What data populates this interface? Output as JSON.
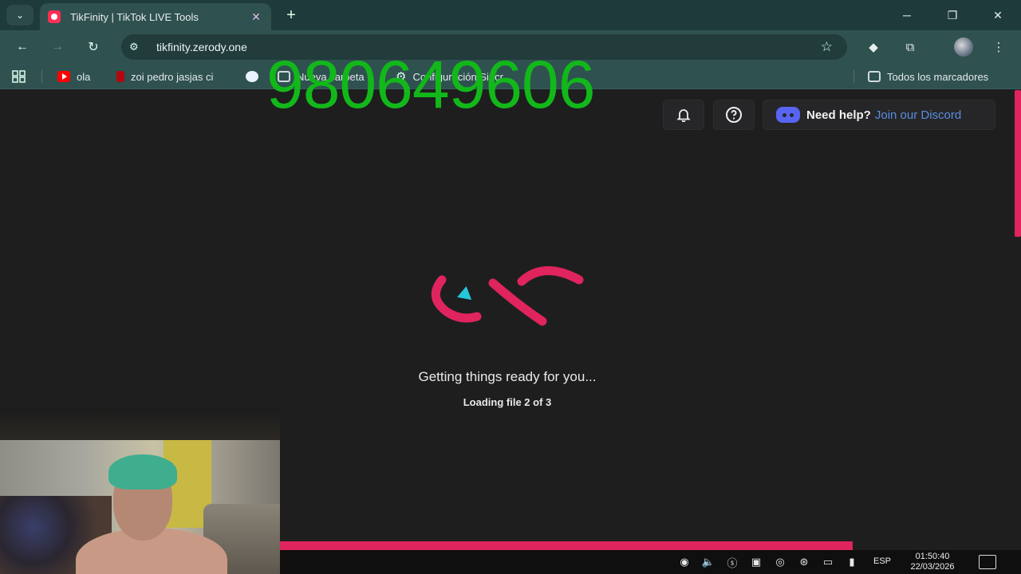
{
  "browser": {
    "tab": {
      "title": "TikFinity | TikTok LIVE Tools",
      "close": "✕"
    },
    "new_tab": "+",
    "window_controls": {
      "minimize": "─",
      "maximize": "❐",
      "close": "✕"
    },
    "url": "tikfinity.zerody.one",
    "bookmarks": [
      {
        "label": "ola",
        "icon": "youtube-icon"
      },
      {
        "label": "zoi pedro jasjas ci",
        "icon": "netflix-icon"
      },
      {
        "label": "",
        "icon": "whatsapp-icon"
      },
      {
        "label": "Nueva carpeta",
        "icon": "folder-icon"
      },
      {
        "label": "Configuración Sincr...",
        "icon": "gear-icon"
      }
    ],
    "all_bookmarks": "Todos los marcadores"
  },
  "overlay": {
    "number": "980649606"
  },
  "page": {
    "help": {
      "strong": "Need help?",
      "link": "Join our Discord"
    },
    "status": "Getting things ready for you...",
    "loading": "Loading file 2 of 3",
    "progress": 0.78
  },
  "taskbar": {
    "language": "ESP",
    "time": "01:50:40",
    "date": "22/03/2026"
  },
  "colors": {
    "accent": "#e0245e",
    "overlay_text": "#12b81a",
    "browser_frame": "#2f5150",
    "discord": "#5865f2"
  }
}
